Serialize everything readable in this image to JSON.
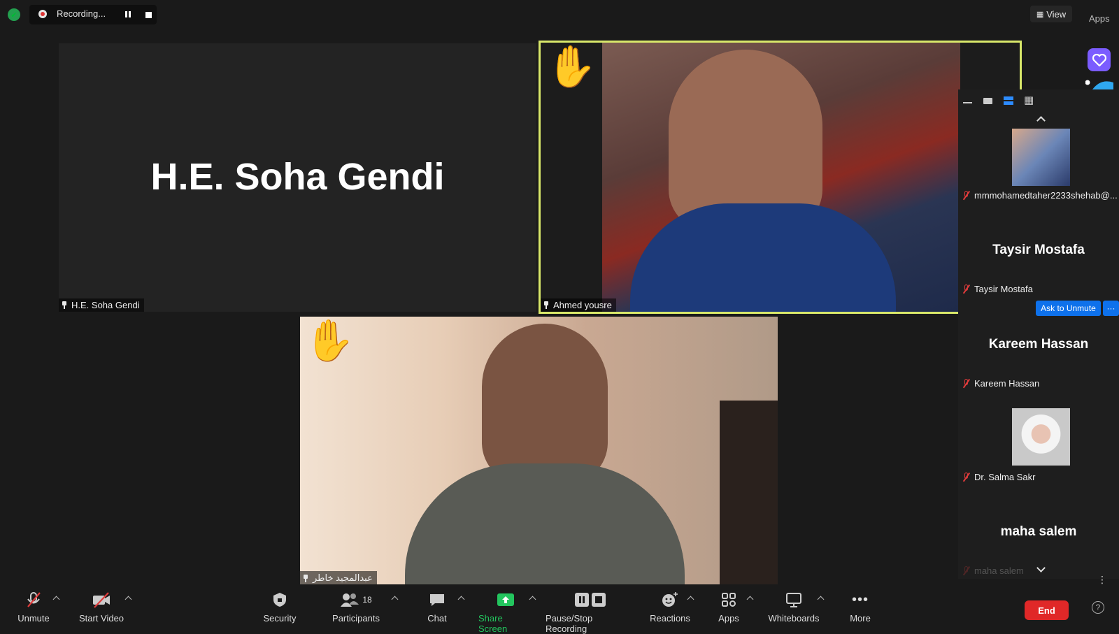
{
  "topbar": {
    "recording_label": "Recording...",
    "view_label": "View",
    "apps_label": "Apps"
  },
  "tiles": [
    {
      "display_name": "H.E. Soha Gendi",
      "tag": "H.E. Soha Gendi"
    },
    {
      "tag": "Ahmed yousre"
    },
    {
      "tag": "عبدالمجيد خاطر"
    }
  ],
  "panel": {
    "participants": [
      {
        "tag": "mmmohamedtaher2233shehab@..."
      },
      {
        "display_name": "Taysir Mostafa",
        "tag": "Taysir Mostafa"
      },
      {
        "display_name": "Kareem Hassan",
        "tag": "Kareem Hassan"
      },
      {
        "tag": "Dr. Salma Sakr"
      },
      {
        "display_name": "maha  salem",
        "tag": "maha  salem"
      }
    ],
    "ask_to_unmute": "Ask to Unmute",
    "more_label": "···"
  },
  "toolbar": {
    "unmute": "Unmute",
    "start_video": "Start Video",
    "security": "Security",
    "participants": "Participants",
    "participant_count": "18",
    "chat": "Chat",
    "share_screen": "Share Screen",
    "pause_stop_recording": "Pause/Stop Recording",
    "reactions": "Reactions",
    "apps": "Apps",
    "whiteboards": "Whiteboards",
    "more": "More",
    "end": "End"
  },
  "colors": {
    "active_speaker_border": "#d9e86a",
    "end": "#e02828",
    "share": "#23c55e",
    "accent": "#0e71eb"
  },
  "icons": [
    "shield-icon",
    "record-icon",
    "pause-icon",
    "stop-icon",
    "view-grid-icon",
    "heart-app-icon",
    "raised-hand-icon",
    "pin-icon",
    "muted-mic-icon",
    "video-off-icon",
    "security-icon",
    "participants-icon",
    "chat-icon",
    "share-screen-icon",
    "recording-control-icon",
    "reactions-icon",
    "apps-icon",
    "whiteboard-icon",
    "more-icon",
    "help-icon"
  ]
}
